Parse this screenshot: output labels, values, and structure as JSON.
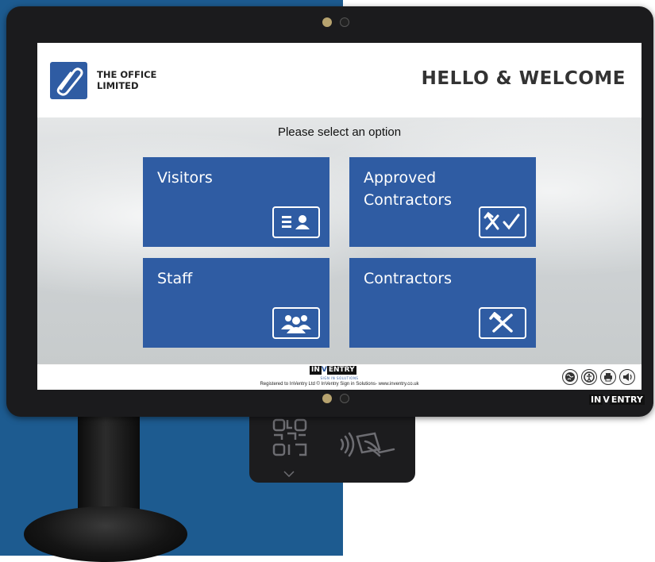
{
  "header": {
    "company_line1": "THE OFFICE",
    "company_line2": "LIMITED",
    "welcome": "HELLO & WELCOME"
  },
  "main": {
    "prompt": "Please select an option",
    "tiles": [
      {
        "label": "Visitors",
        "icon": "id-card-icon"
      },
      {
        "label": "Approved\nContractors",
        "icon": "tools-check-icon"
      },
      {
        "label": "Staff",
        "icon": "group-icon"
      },
      {
        "label": "Contractors",
        "icon": "tools-icon"
      }
    ]
  },
  "footer": {
    "brand_in": "IN",
    "brand_v": "V",
    "brand_entry": "ENTRY",
    "tagline": "SIGN IN SOLUTIONS",
    "copyright": "Registered to InVentry Ltd © InVentry Sign in Solutions- www.inventry.co.uk",
    "buttons": [
      "globe-icon",
      "accessibility-icon",
      "print-icon",
      "sound-icon"
    ]
  },
  "bezel": {
    "brand_in": "IN",
    "brand_v": "V",
    "brand_entry": "ENTRY"
  },
  "colors": {
    "tile": "#2f5ca3",
    "background_left": "#1d5b90",
    "bezel": "#1b1b1d"
  }
}
